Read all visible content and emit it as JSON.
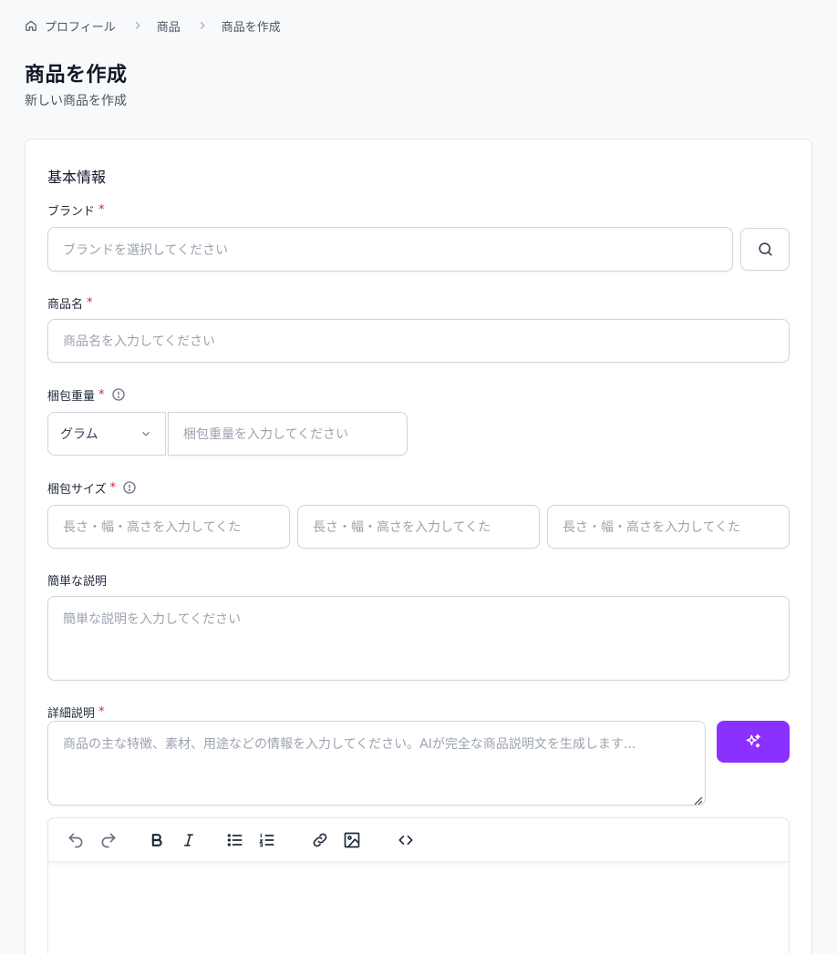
{
  "breadcrumb": {
    "home_label": "プロフィール",
    "products_label": "商品",
    "current_label": "商品を作成"
  },
  "page": {
    "title": "商品を作成",
    "subtitle": "新しい商品を作成"
  },
  "form": {
    "section_title": "基本情報",
    "brand": {
      "label": "ブランド",
      "placeholder": "ブランドを選択してください"
    },
    "product_name": {
      "label": "商品名",
      "placeholder": "商品名を入力してください"
    },
    "package_weight": {
      "label": "梱包重量",
      "unit": "グラム",
      "placeholder": "梱包重量を入力してください"
    },
    "package_size": {
      "label": "梱包サイズ",
      "placeholder_1": "長さ・幅・高さを入力してくた",
      "placeholder_2": "長さ・幅・高さを入力してくた",
      "placeholder_3": "長さ・幅・高さを入力してくた"
    },
    "short_description": {
      "label": "簡単な説明",
      "placeholder": "簡単な説明を入力してください"
    },
    "detail_description": {
      "label": "詳細説明",
      "placeholder": "商品の主な特徴、素材、用途などの情報を入力してください。AIが完全な商品説明文を生成します..."
    },
    "required_mark": "*"
  },
  "colors": {
    "accent": "#8b31ff",
    "required": "#dc2626"
  },
  "icons": {
    "brand_search": "search-icon",
    "ai_generate": "sparkles-icon"
  }
}
